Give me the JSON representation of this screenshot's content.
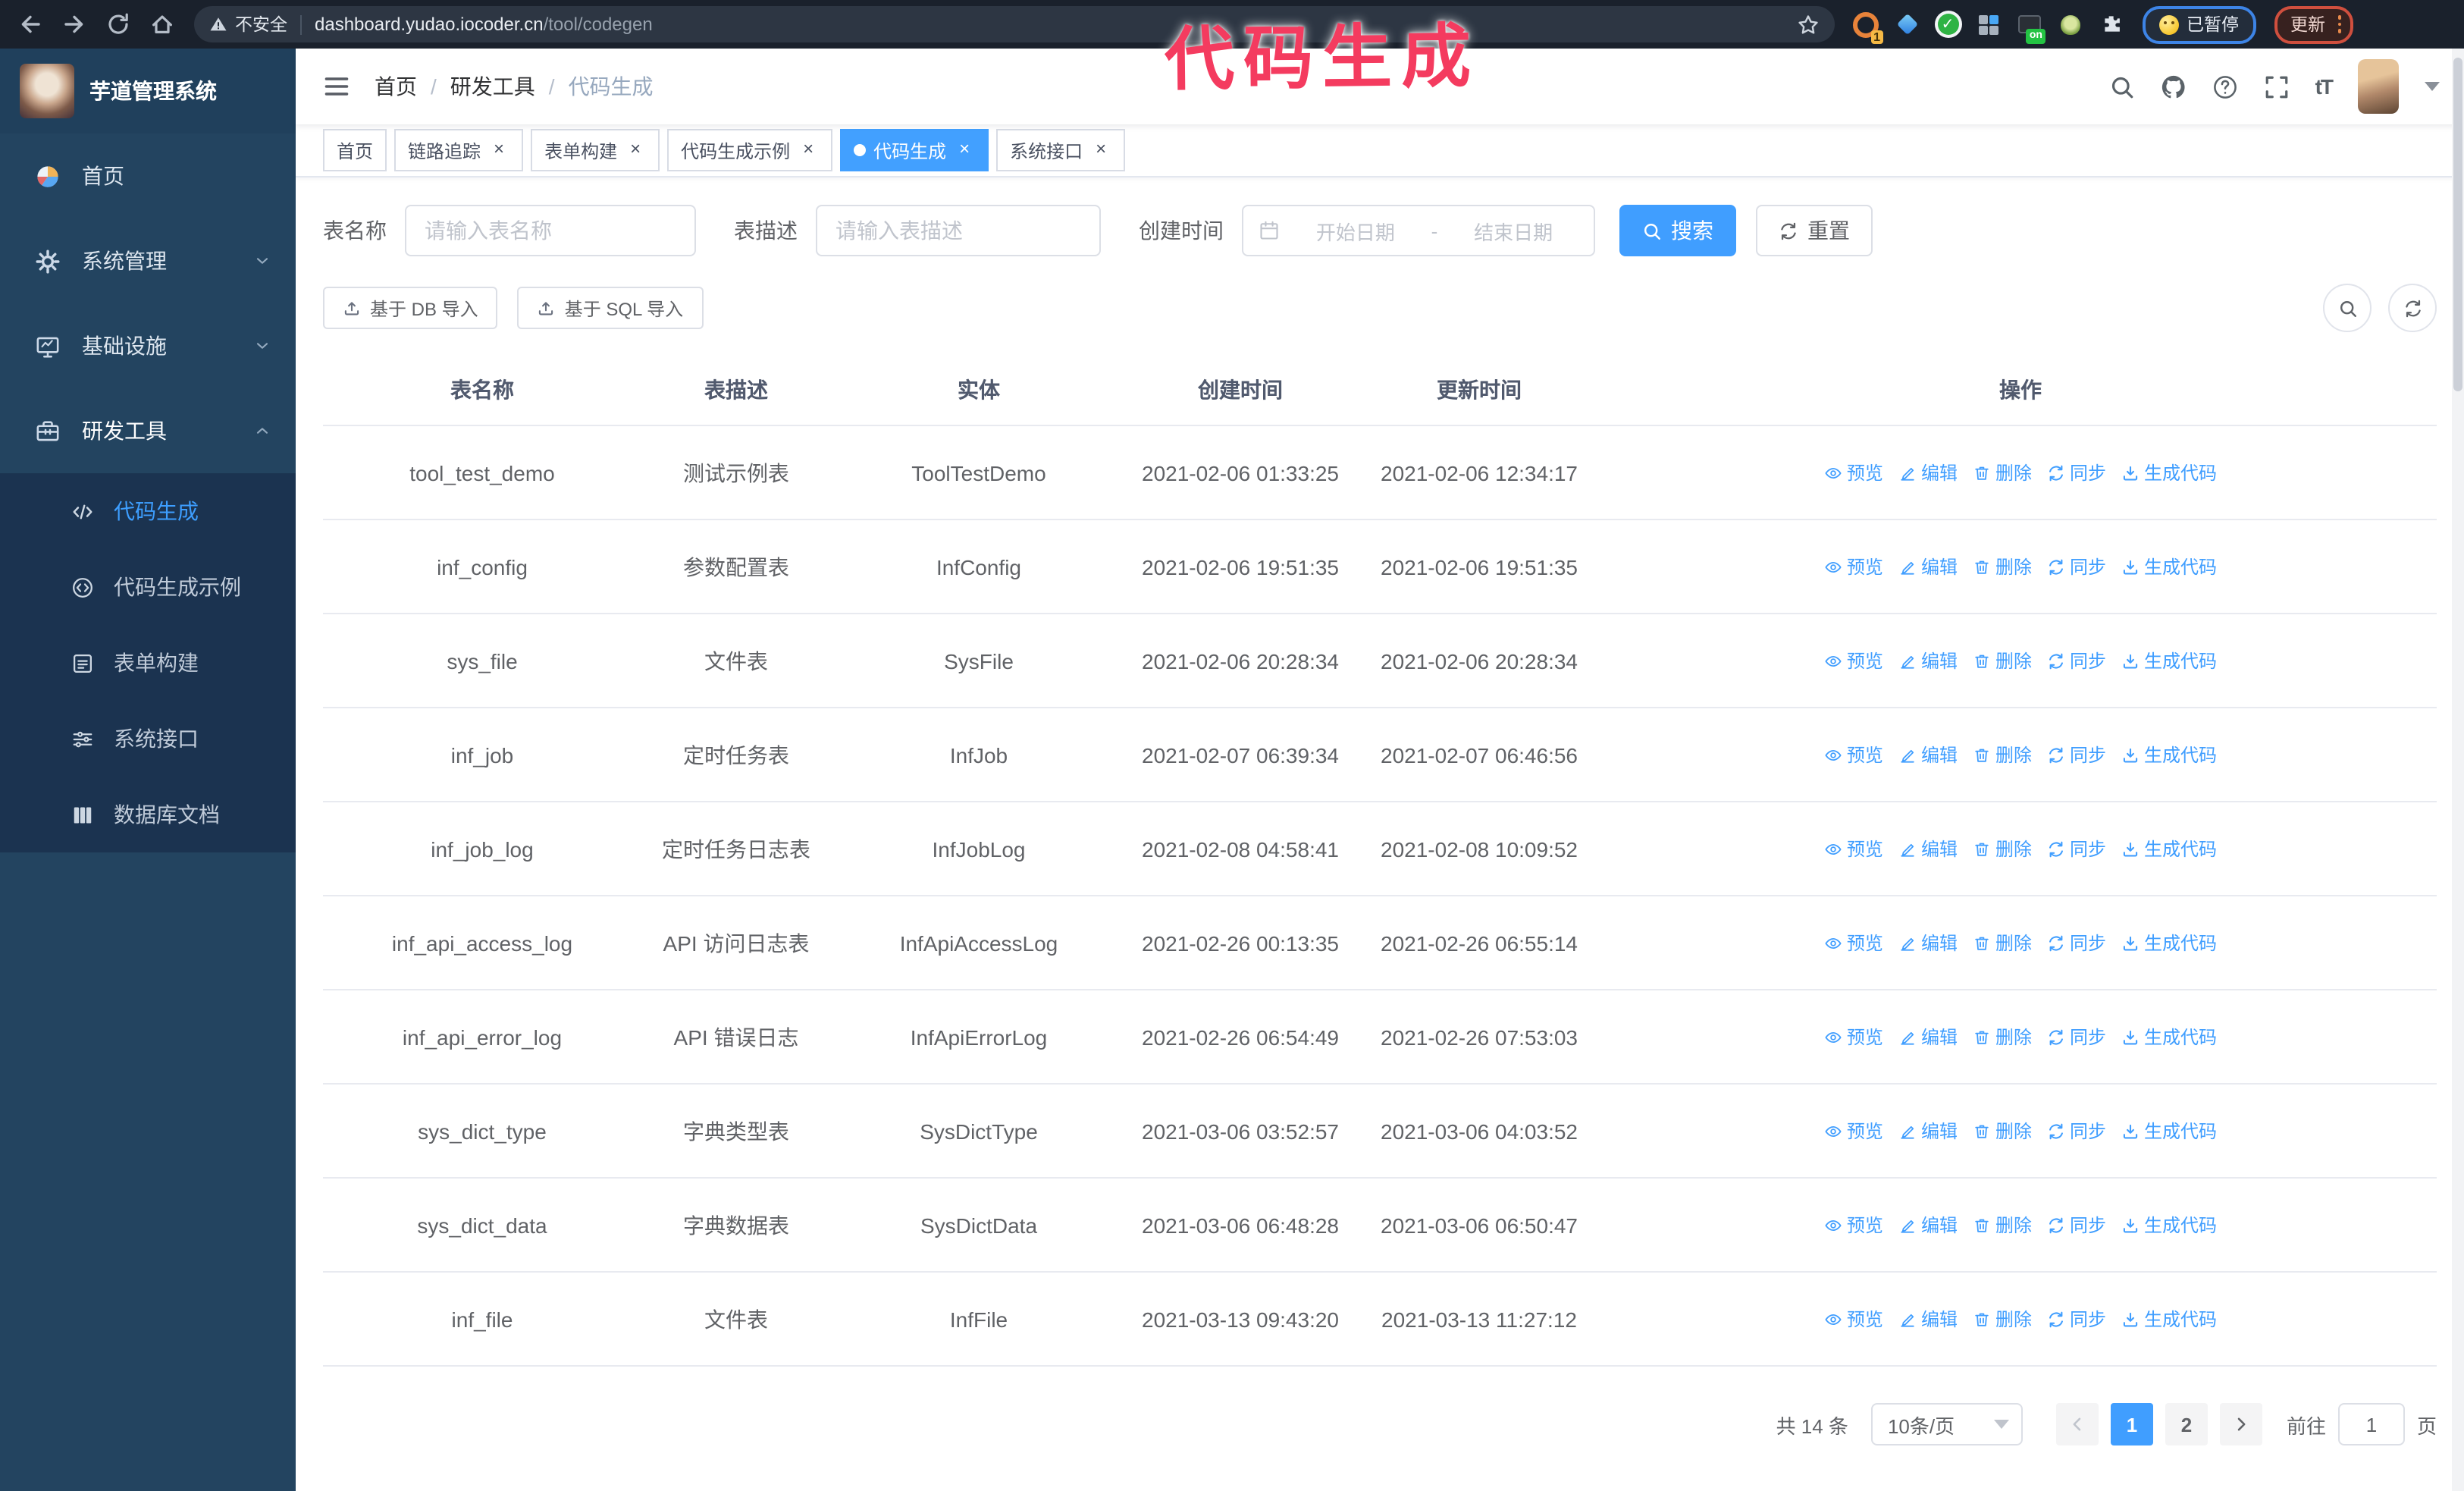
{
  "browser": {
    "security_label": "不安全",
    "url_domain": "dashboard.yudao.iocoder.cn",
    "url_path": "/tool/codegen",
    "paused_chip": "已暂停",
    "update_chip": "更新",
    "extensions": [
      {
        "name": "extension-icon-orange-ring",
        "kind": "orange-ring",
        "badge": "1"
      },
      {
        "name": "extension-icon-blue-diamond",
        "kind": "diamond"
      },
      {
        "name": "extension-icon-green-check",
        "kind": "green-check"
      },
      {
        "name": "extension-icon-grid",
        "kind": "grid"
      },
      {
        "name": "extension-icon-dark-on",
        "kind": "dark-on",
        "badge": "on"
      },
      {
        "name": "extension-icon-green-monkey",
        "kind": "monkey"
      },
      {
        "name": "extensions-puzzle-icon",
        "kind": "puzzle"
      }
    ]
  },
  "annotation": {
    "text": "代码生成",
    "color": "#f43b5f"
  },
  "app": {
    "logo_title": "芋道管理系统",
    "breadcrumb": [
      "首页",
      "研发工具",
      "代码生成"
    ],
    "breadcrumb_sep": "/"
  },
  "sidebar": {
    "items": [
      {
        "key": "home",
        "label": "首页",
        "icon": "dashboard-icon"
      },
      {
        "key": "system-admin",
        "label": "系统管理",
        "icon": "gear-icon",
        "chevron": "down"
      },
      {
        "key": "infrastructure",
        "label": "基础设施",
        "icon": "monitor-icon",
        "chevron": "down"
      },
      {
        "key": "dev-tools",
        "label": "研发工具",
        "icon": "toolbox-icon",
        "chevron": "up",
        "active": true
      }
    ],
    "submenu": [
      {
        "key": "codegen",
        "label": "代码生成",
        "icon": "code-icon",
        "active": true
      },
      {
        "key": "codegen-example",
        "label": "代码生成示例",
        "icon": "code-example-icon"
      },
      {
        "key": "form-builder",
        "label": "表单构建",
        "icon": "form-icon"
      },
      {
        "key": "system-api",
        "label": "系统接口",
        "icon": "api-icon"
      },
      {
        "key": "db-doc",
        "label": "数据库文档",
        "icon": "database-icon"
      }
    ]
  },
  "tags": [
    {
      "label": "首页",
      "closable": false,
      "active": false
    },
    {
      "label": "链路追踪",
      "closable": true,
      "active": false
    },
    {
      "label": "表单构建",
      "closable": true,
      "active": false
    },
    {
      "label": "代码生成示例",
      "closable": true,
      "active": false
    },
    {
      "label": "代码生成",
      "closable": true,
      "active": true
    },
    {
      "label": "系统接口",
      "closable": true,
      "active": false
    }
  ],
  "search": {
    "name_label": "表名称",
    "name_placeholder": "请输入表名称",
    "desc_label": "表描述",
    "desc_placeholder": "请输入表描述",
    "date_label": "创建时间",
    "date_start_placeholder": "开始日期",
    "date_separator": "-",
    "date_end_placeholder": "结束日期",
    "search_button": "搜索",
    "reset_button": "重置"
  },
  "toolbar": {
    "import_db_button": "基于 DB 导入",
    "import_sql_button": "基于 SQL 导入"
  },
  "table": {
    "columns": [
      "表名称",
      "表描述",
      "实体",
      "创建时间",
      "更新时间",
      "操作"
    ],
    "row_actions": [
      {
        "key": "preview",
        "label": "预览",
        "icon": "eye-icon"
      },
      {
        "key": "edit",
        "label": "编辑",
        "icon": "edit-icon"
      },
      {
        "key": "delete",
        "label": "删除",
        "icon": "delete-icon"
      },
      {
        "key": "sync",
        "label": "同步",
        "icon": "sync-icon"
      },
      {
        "key": "generate",
        "label": "生成代码",
        "icon": "download-icon"
      }
    ],
    "rows": [
      {
        "name": "tool_test_demo",
        "desc": "测试示例表",
        "entity": "ToolTestDemo",
        "created": "2021-02-06 01:33:25",
        "updated": "2021-02-06 12:34:17",
        "created_wrap": false,
        "updated_wrap": false
      },
      {
        "name": "inf_config",
        "desc": "参数配置表",
        "entity": "InfConfig",
        "created": "2021-02-06 19:51:35",
        "updated": "2021-02-06 19:51:35",
        "created_wrap": false,
        "updated_wrap": false
      },
      {
        "name": "sys_file",
        "desc": "文件表",
        "entity": "SysFile",
        "created": "2021-02-06 20:28:34",
        "updated": "2021-02-06 20:28:34",
        "created_wrap": true,
        "updated_wrap": true
      },
      {
        "name": "inf_job",
        "desc": "定时任务表",
        "entity": "InfJob",
        "created": "2021-02-07 06:39:34",
        "updated": "2021-02-07 06:46:56",
        "created_wrap": true,
        "updated_wrap": true
      },
      {
        "name": "inf_job_log",
        "desc": "定时任务日志表",
        "entity": "InfJobLog",
        "created": "2021-02-08 04:58:41",
        "updated": "2021-02-08 10:09:52",
        "created_wrap": true,
        "updated_wrap": true
      },
      {
        "name": "inf_api_access_log",
        "desc": "API 访问日志表",
        "entity": "InfApiAccessLog",
        "created": "2021-02-26 00:13:35",
        "updated": "2021-02-26 06:55:14",
        "created_wrap": false,
        "updated_wrap": true
      },
      {
        "name": "inf_api_error_log",
        "desc": "API 错误日志",
        "entity": "InfApiErrorLog",
        "created": "2021-02-26 06:54:49",
        "updated": "2021-02-26 07:53:03",
        "created_wrap": true,
        "updated_wrap": true
      },
      {
        "name": "sys_dict_type",
        "desc": "字典类型表",
        "entity": "SysDictType",
        "created": "2021-03-06 03:52:57",
        "updated": "2021-03-06 04:03:52",
        "created_wrap": true,
        "updated_wrap": true
      },
      {
        "name": "sys_dict_data",
        "desc": "字典数据表",
        "entity": "SysDictData",
        "created": "2021-03-06 06:48:28",
        "updated": "2021-03-06 06:50:47",
        "created_wrap": true,
        "updated_wrap": true
      },
      {
        "name": "inf_file",
        "desc": "文件表",
        "entity": "InfFile",
        "created": "2021-03-13 09:43:20",
        "updated": "2021-03-13 11:27:12",
        "created_wrap": true,
        "updated_wrap": false
      }
    ]
  },
  "pagination": {
    "total": "共 14 条",
    "page_size": "10条/页",
    "pages": [
      "1",
      "2"
    ],
    "active_page": "1",
    "goto_label": "前往",
    "goto_value": "1",
    "goto_suffix": "页"
  },
  "colors": {
    "primary": "#409eff",
    "annotation": "#f43b5f",
    "sidebar_bg": "#234460",
    "submenu_bg": "#1b3350"
  }
}
